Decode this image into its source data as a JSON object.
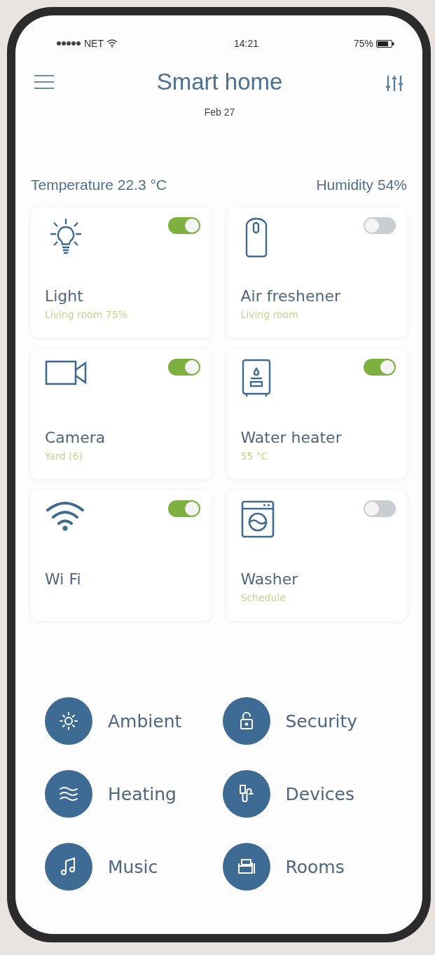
{
  "status_bar": {
    "carrier": "NET",
    "time": "14:21",
    "battery": "75%"
  },
  "header": {
    "title": "Smart home",
    "date": "Feb 27"
  },
  "readings": {
    "temperature": "Temperature 22.3 °C",
    "humidity": "Humidity 54%"
  },
  "devices": [
    {
      "name": "Light",
      "detail": "Living room 75%",
      "on": true
    },
    {
      "name": "Air freshener",
      "detail": "Living room",
      "on": false
    },
    {
      "name": "Camera",
      "detail": "Yard (6)",
      "on": true
    },
    {
      "name": "Water heater",
      "detail": "55 °C",
      "on": true
    },
    {
      "name": "Wi Fi",
      "on": true
    },
    {
      "name": "Washer",
      "detail": "Schedule",
      "on": false
    }
  ],
  "categories": [
    {
      "label": "Ambient"
    },
    {
      "label": "Security"
    },
    {
      "label": "Heating"
    },
    {
      "label": "Devices"
    },
    {
      "label": "Music"
    },
    {
      "label": "Rooms"
    }
  ]
}
